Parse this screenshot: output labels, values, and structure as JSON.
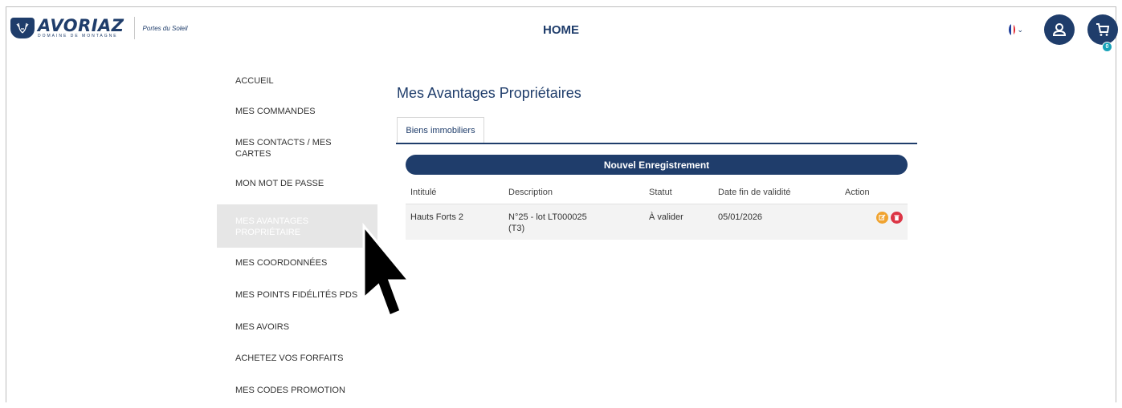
{
  "header": {
    "logo_text": "AVORIAZ",
    "logo_subtext": "DOMAINE DE MONTAGNE",
    "partner_text": "Portes du Soleil",
    "title": "HOME",
    "cart_count": "0"
  },
  "sidebar": {
    "items": [
      {
        "label": "ACCUEIL"
      },
      {
        "label": "MES COMMANDES"
      },
      {
        "label": "MES CONTACTS / MES CARTES"
      },
      {
        "label": "MON MOT DE PASSE"
      },
      {
        "label": "MES AVANTAGES PROPRIÉTAIRE"
      },
      {
        "label": "MES COORDONNÉES"
      },
      {
        "label": "MES POINTS FIDÉLITÉS PDS"
      },
      {
        "label": "MES AVOIRS"
      },
      {
        "label": "ACHETEZ VOS FORFAITS"
      },
      {
        "label": "MES CODES PROMOTION"
      }
    ]
  },
  "main": {
    "title": "Mes Avantages Propriétaires",
    "tab_label": "Biens immobiliers",
    "new_button_label": "Nouvel Enregistrement",
    "table": {
      "headers": [
        "Intitulé",
        "Description",
        "Statut",
        "Date fin de validité",
        "Action"
      ],
      "rows": [
        {
          "intitule": "Hauts Forts 2",
          "description": "N°25 - lot LT000025 (T3)",
          "statut": "À valider",
          "date": "05/01/2026"
        }
      ]
    }
  },
  "colors": {
    "brand_navy": "#1f3d6b",
    "edit_orange": "#f0a32f",
    "delete_red": "#dc3545",
    "badge_teal": "#17a2b8"
  }
}
